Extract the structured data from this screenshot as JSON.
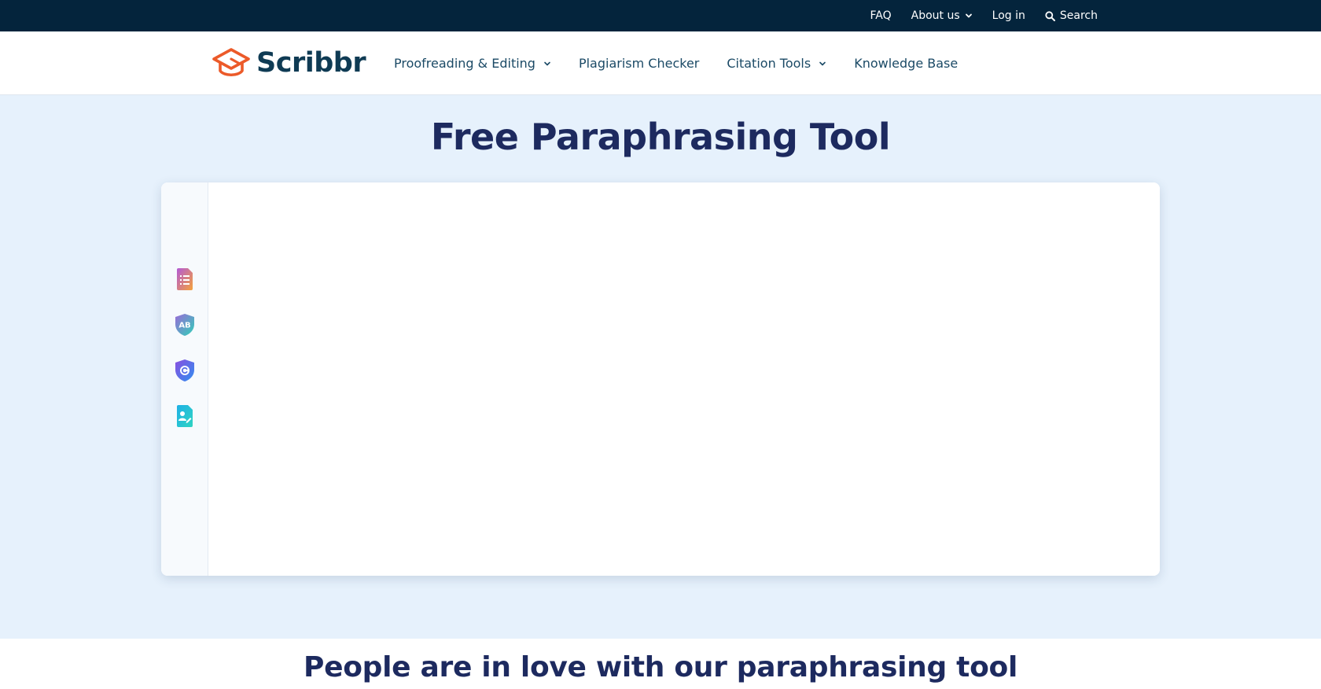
{
  "topbar": {
    "faq": "FAQ",
    "about": "About us",
    "login": "Log in",
    "search": "Search"
  },
  "header": {
    "logo_text": "Scribbr",
    "nav": [
      {
        "label": "Proofreading & Editing",
        "has_dropdown": true
      },
      {
        "label": "Plagiarism Checker",
        "has_dropdown": false
      },
      {
        "label": "Citation Tools",
        "has_dropdown": true
      },
      {
        "label": "Knowledge Base",
        "has_dropdown": false
      }
    ]
  },
  "hero": {
    "title": "Free Paraphrasing Tool"
  },
  "tool": {
    "sidebar_icons": [
      "summarizer-icon",
      "grammar-checker-icon",
      "plagiarism-checker-icon",
      "ai-proofreader-icon"
    ],
    "editor_text": ""
  },
  "reviews": {
    "title": "People are in love with our paraphrasing tool"
  },
  "colors": {
    "topbar_bg": "#04243c",
    "brand_orange": "#ec5a29",
    "brand_navy": "#0f3b54",
    "hero_bg": "#e6f1fc",
    "title_color": "#1d2a5f"
  }
}
